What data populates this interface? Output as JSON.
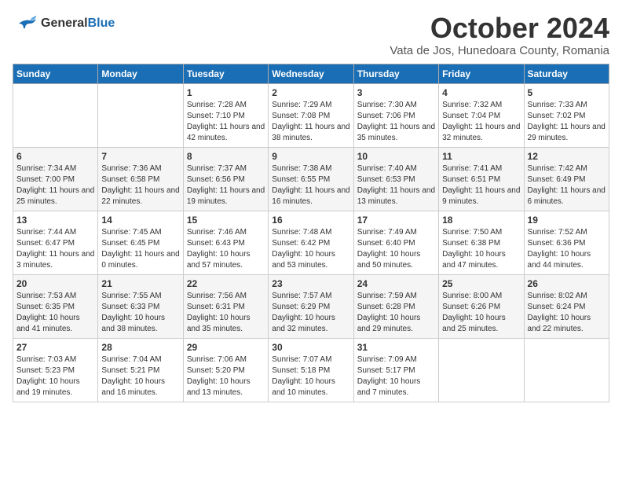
{
  "logo": {
    "line1": "General",
    "line2": "Blue"
  },
  "title": "October 2024",
  "subtitle": "Vata de Jos, Hunedoara County, Romania",
  "days_header": [
    "Sunday",
    "Monday",
    "Tuesday",
    "Wednesday",
    "Thursday",
    "Friday",
    "Saturday"
  ],
  "weeks": [
    [
      {
        "num": "",
        "info": ""
      },
      {
        "num": "",
        "info": ""
      },
      {
        "num": "1",
        "info": "Sunrise: 7:28 AM\nSunset: 7:10 PM\nDaylight: 11 hours and 42 minutes."
      },
      {
        "num": "2",
        "info": "Sunrise: 7:29 AM\nSunset: 7:08 PM\nDaylight: 11 hours and 38 minutes."
      },
      {
        "num": "3",
        "info": "Sunrise: 7:30 AM\nSunset: 7:06 PM\nDaylight: 11 hours and 35 minutes."
      },
      {
        "num": "4",
        "info": "Sunrise: 7:32 AM\nSunset: 7:04 PM\nDaylight: 11 hours and 32 minutes."
      },
      {
        "num": "5",
        "info": "Sunrise: 7:33 AM\nSunset: 7:02 PM\nDaylight: 11 hours and 29 minutes."
      }
    ],
    [
      {
        "num": "6",
        "info": "Sunrise: 7:34 AM\nSunset: 7:00 PM\nDaylight: 11 hours and 25 minutes."
      },
      {
        "num": "7",
        "info": "Sunrise: 7:36 AM\nSunset: 6:58 PM\nDaylight: 11 hours and 22 minutes."
      },
      {
        "num": "8",
        "info": "Sunrise: 7:37 AM\nSunset: 6:56 PM\nDaylight: 11 hours and 19 minutes."
      },
      {
        "num": "9",
        "info": "Sunrise: 7:38 AM\nSunset: 6:55 PM\nDaylight: 11 hours and 16 minutes."
      },
      {
        "num": "10",
        "info": "Sunrise: 7:40 AM\nSunset: 6:53 PM\nDaylight: 11 hours and 13 minutes."
      },
      {
        "num": "11",
        "info": "Sunrise: 7:41 AM\nSunset: 6:51 PM\nDaylight: 11 hours and 9 minutes."
      },
      {
        "num": "12",
        "info": "Sunrise: 7:42 AM\nSunset: 6:49 PM\nDaylight: 11 hours and 6 minutes."
      }
    ],
    [
      {
        "num": "13",
        "info": "Sunrise: 7:44 AM\nSunset: 6:47 PM\nDaylight: 11 hours and 3 minutes."
      },
      {
        "num": "14",
        "info": "Sunrise: 7:45 AM\nSunset: 6:45 PM\nDaylight: 11 hours and 0 minutes."
      },
      {
        "num": "15",
        "info": "Sunrise: 7:46 AM\nSunset: 6:43 PM\nDaylight: 10 hours and 57 minutes."
      },
      {
        "num": "16",
        "info": "Sunrise: 7:48 AM\nSunset: 6:42 PM\nDaylight: 10 hours and 53 minutes."
      },
      {
        "num": "17",
        "info": "Sunrise: 7:49 AM\nSunset: 6:40 PM\nDaylight: 10 hours and 50 minutes."
      },
      {
        "num": "18",
        "info": "Sunrise: 7:50 AM\nSunset: 6:38 PM\nDaylight: 10 hours and 47 minutes."
      },
      {
        "num": "19",
        "info": "Sunrise: 7:52 AM\nSunset: 6:36 PM\nDaylight: 10 hours and 44 minutes."
      }
    ],
    [
      {
        "num": "20",
        "info": "Sunrise: 7:53 AM\nSunset: 6:35 PM\nDaylight: 10 hours and 41 minutes."
      },
      {
        "num": "21",
        "info": "Sunrise: 7:55 AM\nSunset: 6:33 PM\nDaylight: 10 hours and 38 minutes."
      },
      {
        "num": "22",
        "info": "Sunrise: 7:56 AM\nSunset: 6:31 PM\nDaylight: 10 hours and 35 minutes."
      },
      {
        "num": "23",
        "info": "Sunrise: 7:57 AM\nSunset: 6:29 PM\nDaylight: 10 hours and 32 minutes."
      },
      {
        "num": "24",
        "info": "Sunrise: 7:59 AM\nSunset: 6:28 PM\nDaylight: 10 hours and 29 minutes."
      },
      {
        "num": "25",
        "info": "Sunrise: 8:00 AM\nSunset: 6:26 PM\nDaylight: 10 hours and 25 minutes."
      },
      {
        "num": "26",
        "info": "Sunrise: 8:02 AM\nSunset: 6:24 PM\nDaylight: 10 hours and 22 minutes."
      }
    ],
    [
      {
        "num": "27",
        "info": "Sunrise: 7:03 AM\nSunset: 5:23 PM\nDaylight: 10 hours and 19 minutes."
      },
      {
        "num": "28",
        "info": "Sunrise: 7:04 AM\nSunset: 5:21 PM\nDaylight: 10 hours and 16 minutes."
      },
      {
        "num": "29",
        "info": "Sunrise: 7:06 AM\nSunset: 5:20 PM\nDaylight: 10 hours and 13 minutes."
      },
      {
        "num": "30",
        "info": "Sunrise: 7:07 AM\nSunset: 5:18 PM\nDaylight: 10 hours and 10 minutes."
      },
      {
        "num": "31",
        "info": "Sunrise: 7:09 AM\nSunset: 5:17 PM\nDaylight: 10 hours and 7 minutes."
      },
      {
        "num": "",
        "info": ""
      },
      {
        "num": "",
        "info": ""
      }
    ]
  ]
}
